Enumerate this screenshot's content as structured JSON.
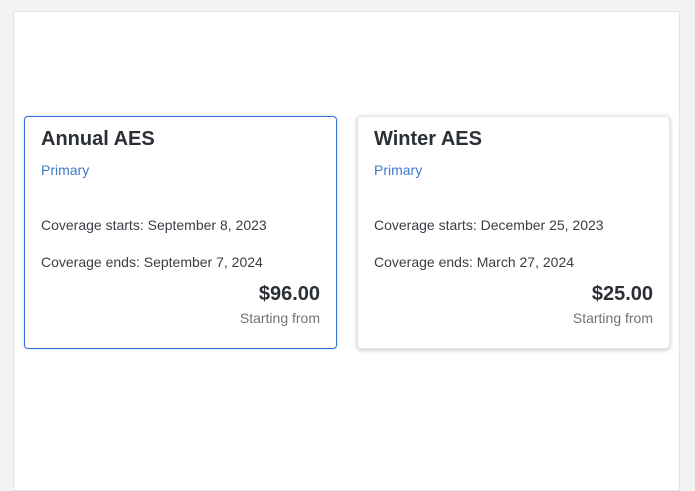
{
  "plans": [
    {
      "title": "Annual AES",
      "type": "Primary",
      "coverage_starts": "Coverage starts: September 8, 2023",
      "coverage_ends": "Coverage ends: September 7, 2024",
      "price": "$96.00",
      "price_note": "Starting from",
      "selected": true
    },
    {
      "title": "Winter AES",
      "type": "Primary",
      "coverage_starts": "Coverage starts: December 25, 2023",
      "coverage_ends": "Coverage ends: March 27, 2024",
      "price": "$25.00",
      "price_note": "Starting from",
      "selected": false
    }
  ],
  "colors": {
    "selected_border": "#3a6fd8",
    "link_blue": "#3f78c9",
    "heading": "#2b2f36",
    "muted": "#6e7279"
  }
}
